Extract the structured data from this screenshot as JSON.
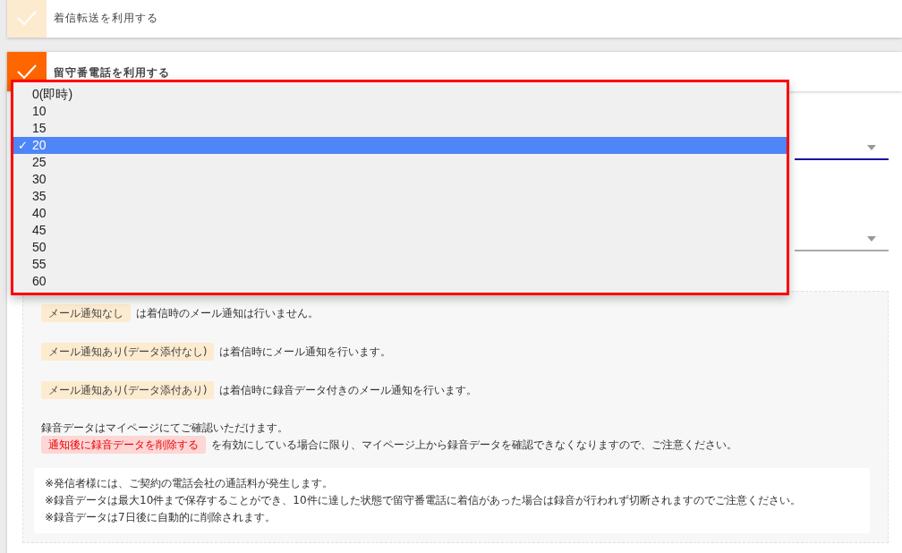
{
  "options": [
    {
      "label": "着信転送を利用する",
      "checked": false
    },
    {
      "label": "留守番電話を利用する",
      "checked": true
    }
  ],
  "selects": [
    {
      "focused": true
    },
    {
      "focused": false
    }
  ],
  "dropdown": {
    "items": [
      {
        "label": "0(即時)",
        "selected": false
      },
      {
        "label": "10",
        "selected": false
      },
      {
        "label": "15",
        "selected": false
      },
      {
        "label": "20",
        "selected": true
      },
      {
        "label": "25",
        "selected": false
      },
      {
        "label": "30",
        "selected": false
      },
      {
        "label": "35",
        "selected": false
      },
      {
        "label": "40",
        "selected": false
      },
      {
        "label": "45",
        "selected": false
      },
      {
        "label": "50",
        "selected": false
      },
      {
        "label": "55",
        "selected": false
      },
      {
        "label": "60",
        "selected": false
      }
    ],
    "check_mark": "✓"
  },
  "notes": [
    {
      "tag": "メール通知なし",
      "alert": false,
      "text": "は着信時のメール通知は行いません。"
    },
    {
      "tag": "メール通知あり(データ添付なし)",
      "alert": false,
      "text": "は着信時にメール通知を行います。"
    },
    {
      "tag": "メール通知あり(データ添付あり)",
      "alert": false,
      "text": "は着信時に録音データ付きのメール通知を行います。"
    }
  ],
  "recording_note": {
    "intro": "録音データはマイページにてご確認いただけます。",
    "tag": "通知後に録音データを削除する",
    "alert": true,
    "text": "を有効にしている場合に限り、マイページ上から録音データを確認できなくなりますので、ご注意ください。"
  },
  "footnotes": [
    "※発信者様には、ご契約の電話会社の通話料が発生します。",
    "※録音データは最大10件まで保存することができ、10件に達した状態で留守番電話に着信があった場合は録音が行われず切断されますのでご注意ください。",
    "※録音データは7日後に自動的に削除されます。"
  ]
}
